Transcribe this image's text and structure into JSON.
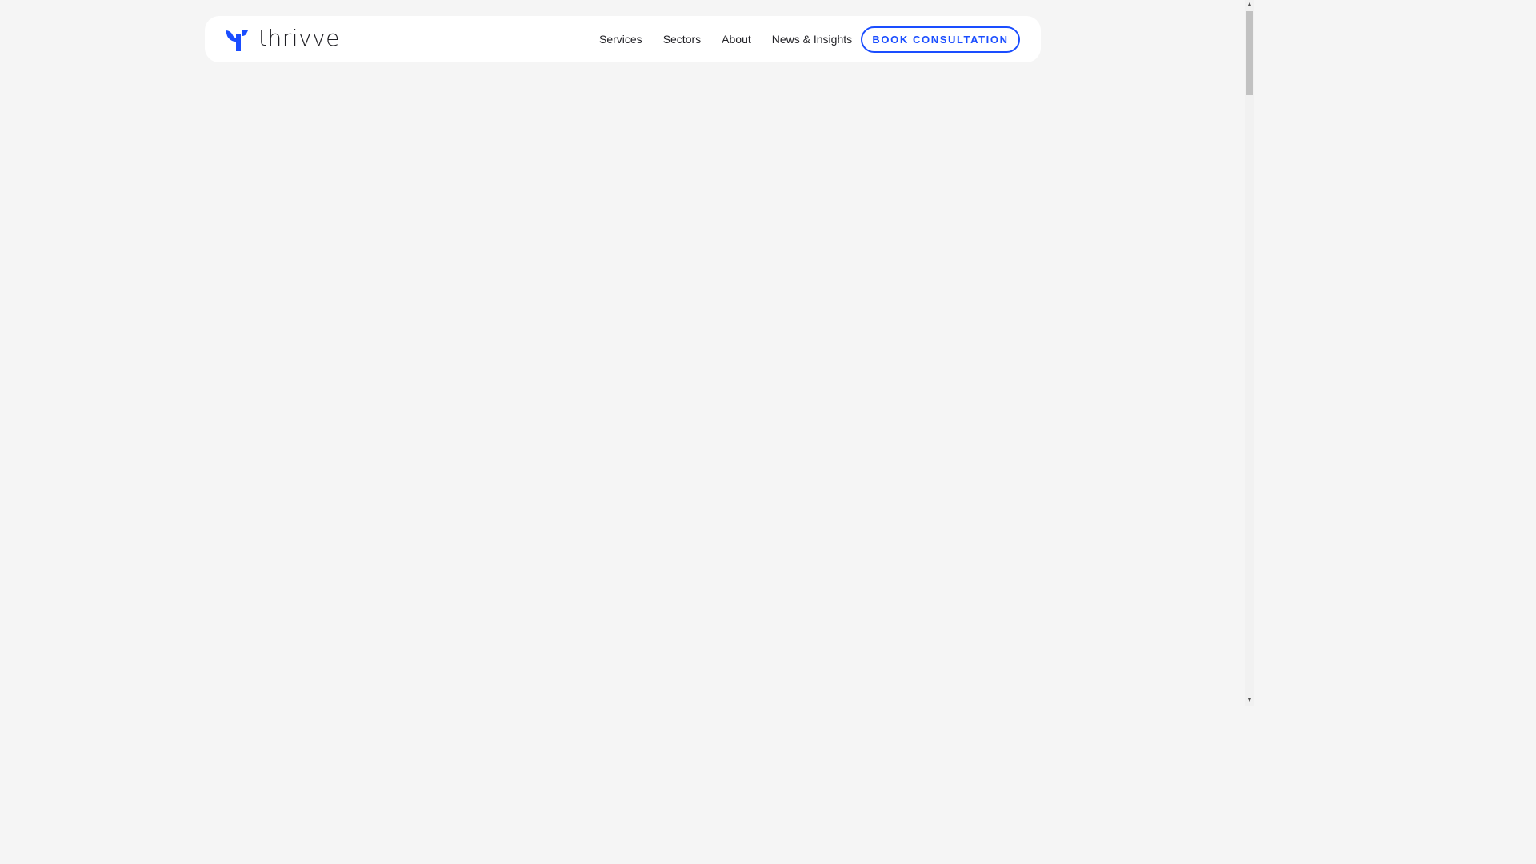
{
  "brand": {
    "name": "thrivve",
    "accent_color": "#1a4dff",
    "text_color": "#1f1f24"
  },
  "nav": {
    "items": [
      {
        "label": "Services"
      },
      {
        "label": "Sectors"
      },
      {
        "label": "About"
      },
      {
        "label": "News & Insights"
      }
    ],
    "cta_label": "BOOK CONSULTATION"
  },
  "scrollbar": {
    "up_icon": "arrow-up-icon",
    "down_icon": "arrow-down-icon",
    "up_glyph": "▲",
    "down_glyph": "▼",
    "position_fraction": 0.0
  }
}
